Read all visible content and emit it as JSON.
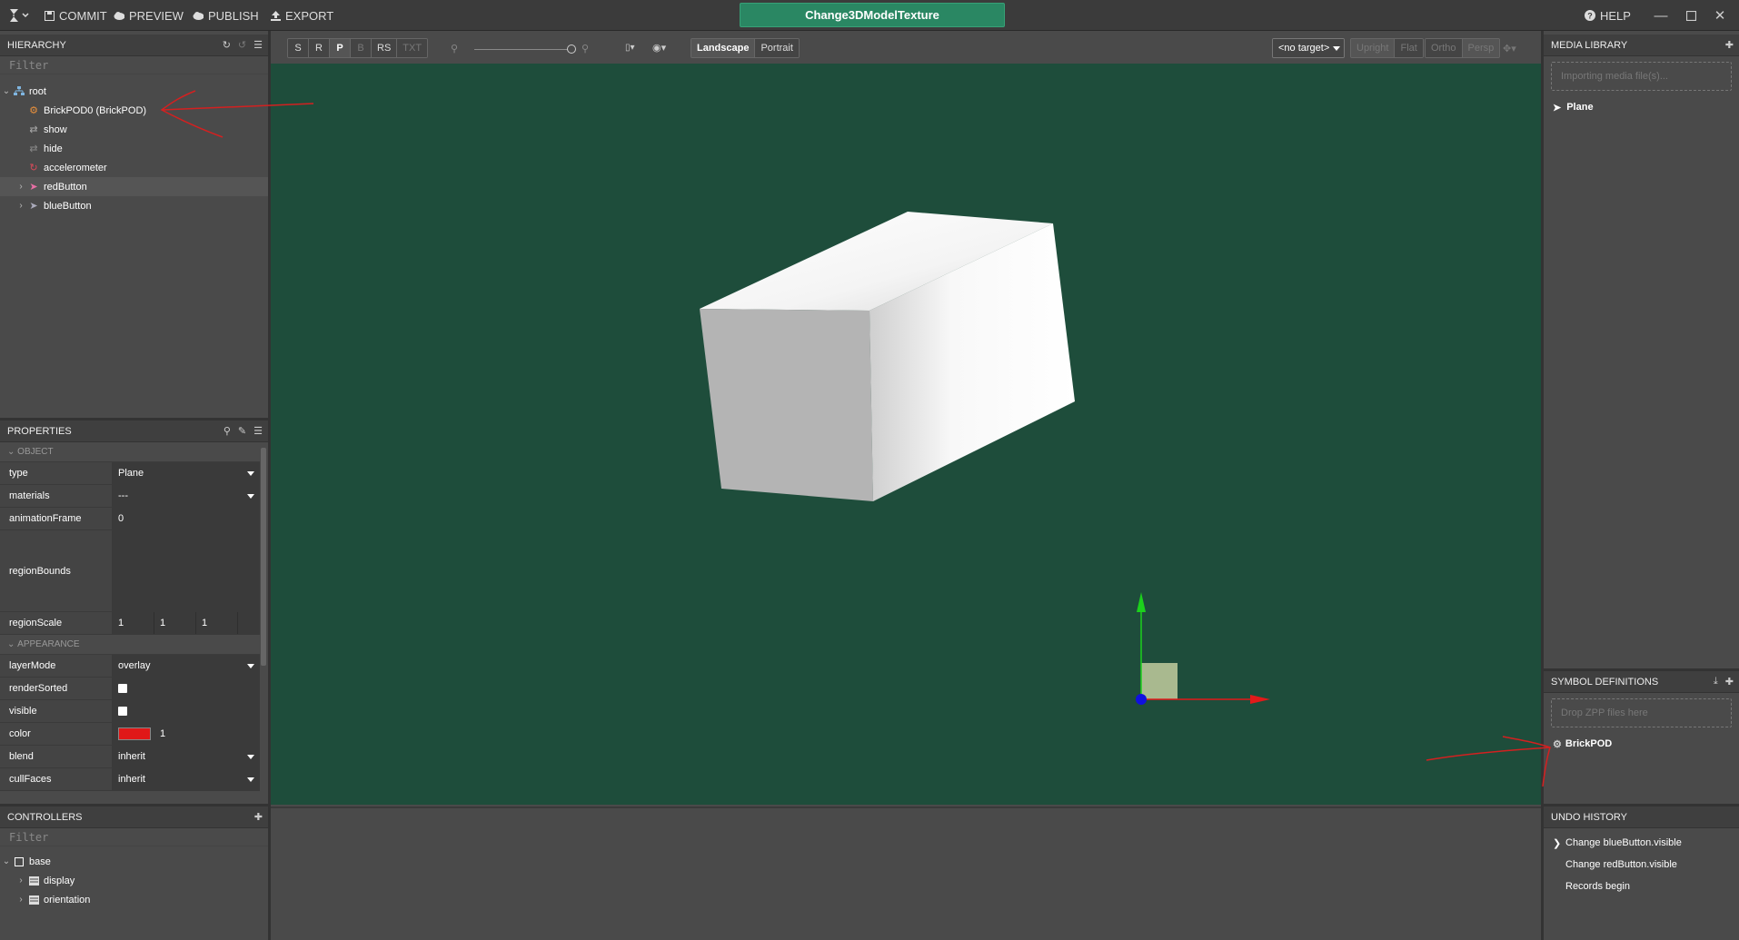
{
  "topbar": {
    "commit": "COMMIT",
    "preview": "PREVIEW",
    "publish": "PUBLISH",
    "export": "EXPORT",
    "project_name": "Change3DModelTexture",
    "help": "HELP"
  },
  "hierarchy": {
    "title": "HIERARCHY",
    "filter_placeholder": "Filter",
    "items": [
      {
        "label": "root",
        "icon": "hierarchy-icon"
      },
      {
        "label": "BrickPOD0 (BrickPOD)",
        "icon": "gear-icon"
      },
      {
        "label": "show",
        "icon": "shuffle-icon"
      },
      {
        "label": "hide",
        "icon": "shuffle-icon"
      },
      {
        "label": "accelerometer",
        "icon": "refresh-icon"
      },
      {
        "label": "redButton",
        "icon": "rocket-icon"
      },
      {
        "label": "blueButton",
        "icon": "rocket-icon"
      }
    ]
  },
  "properties": {
    "title": "PROPERTIES",
    "section_object": "OBJECT",
    "section_appearance": "APPEARANCE",
    "rows": {
      "type": {
        "key": "type",
        "value": "Plane"
      },
      "materials": {
        "key": "materials",
        "value": "---"
      },
      "animationFrame": {
        "key": "animationFrame",
        "value": "0"
      },
      "regionBounds": {
        "key": "regionBounds",
        "value": ""
      },
      "regionScale": {
        "key": "regionScale",
        "v1": "1",
        "v2": "1",
        "v3": "1"
      },
      "layerMode": {
        "key": "layerMode",
        "value": "overlay"
      },
      "renderSorted": {
        "key": "renderSorted"
      },
      "visible": {
        "key": "visible"
      },
      "color": {
        "key": "color",
        "alpha": "1",
        "hex": "#e01818"
      },
      "blend": {
        "key": "blend",
        "value": "inherit"
      },
      "cullFaces": {
        "key": "cullFaces",
        "value": "inherit"
      }
    }
  },
  "controllers": {
    "title": "CONTROLLERS",
    "filter_placeholder": "Filter",
    "items": [
      {
        "label": "base"
      },
      {
        "label": "display"
      },
      {
        "label": "orientation"
      }
    ]
  },
  "viewport_toolbar": {
    "modes": [
      "S",
      "R",
      "P",
      "B",
      "RS",
      "TXT"
    ],
    "landscape": "Landscape",
    "portrait": "Portrait",
    "target": "<no target>",
    "views": [
      "Upright",
      "Flat",
      "Ortho",
      "Persp"
    ]
  },
  "media_library": {
    "title": "MEDIA LIBRARY",
    "dropzone": "Importing media file(s)...",
    "items": [
      {
        "label": "Plane"
      }
    ]
  },
  "symbol_definitions": {
    "title": "SYMBOL DEFINITIONS",
    "dropzone": "Drop ZPP files here",
    "items": [
      {
        "label": "BrickPOD"
      }
    ]
  },
  "undo_history": {
    "title": "UNDO HISTORY",
    "items": [
      {
        "label": "Change blueButton.visible"
      },
      {
        "label": "Change redButton.visible"
      },
      {
        "label": "Records begin"
      }
    ]
  },
  "colors": {
    "accent": "#2a8763",
    "viewport_bg": "#1e4d3b",
    "panel_bg": "#4a4a4a",
    "color_swatch": "#e01818"
  }
}
